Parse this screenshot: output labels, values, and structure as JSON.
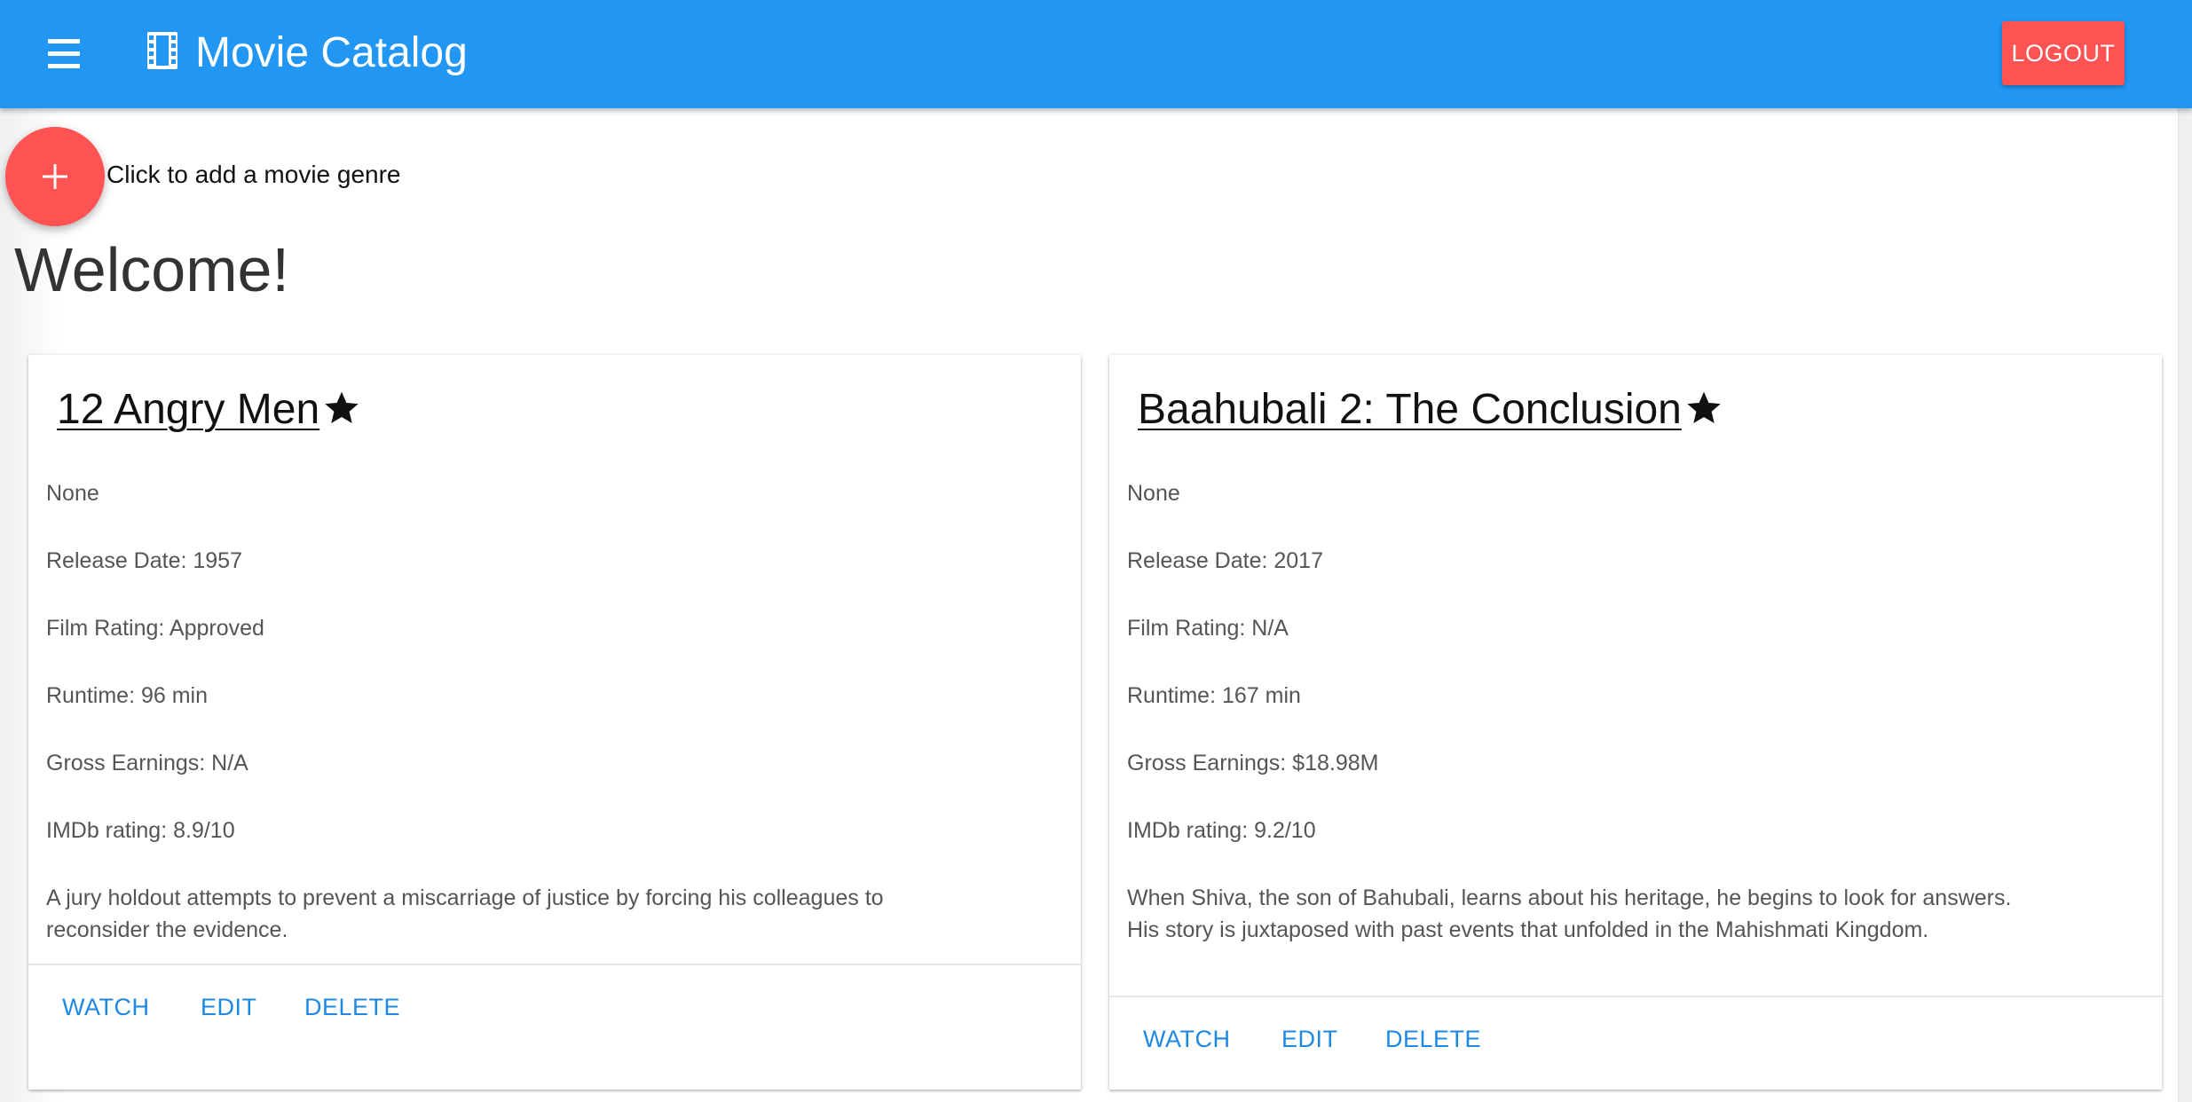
{
  "appbar": {
    "title": "Movie Catalog",
    "menu_icon": "menu-icon",
    "logo_icon": "film-icon",
    "logout_label": "LOGOUT",
    "color": "#2196f3",
    "accent": "#ff5252"
  },
  "fab": {
    "icon": "plus-icon",
    "label": "Click to add a movie genre"
  },
  "page": {
    "heading": "Welcome!"
  },
  "cards": [
    {
      "title": "12 Angry Men",
      "favorite_icon": "star-icon",
      "genre": "None",
      "release": "Release Date: 1957",
      "rating": "Film Rating: Approved",
      "runtime": "Runtime: 96 min",
      "gross": "Gross Earnings: N/A",
      "imdb": "IMDb rating: 8.9/10",
      "plot": "A jury holdout attempts to prevent a miscarriage of justice by forcing his colleagues to reconsider the evidence.",
      "actions": [
        "WATCH",
        "EDIT",
        "DELETE"
      ]
    },
    {
      "title": "Baahubali 2: The Conclusion",
      "favorite_icon": "star-icon",
      "genre": "None",
      "release": "Release Date: 2017",
      "rating": "Film Rating: N/A",
      "runtime": "Runtime: 167 min",
      "gross": "Gross Earnings: $18.98M",
      "imdb": "IMDb rating: 9.2/10",
      "plot": "When Shiva, the son of Bahubali, learns about his heritage, he begins to look for answers. His story is juxtaposed with past events that unfolded in the Mahishmati Kingdom.",
      "actions": [
        "WATCH",
        "EDIT",
        "DELETE"
      ]
    }
  ]
}
